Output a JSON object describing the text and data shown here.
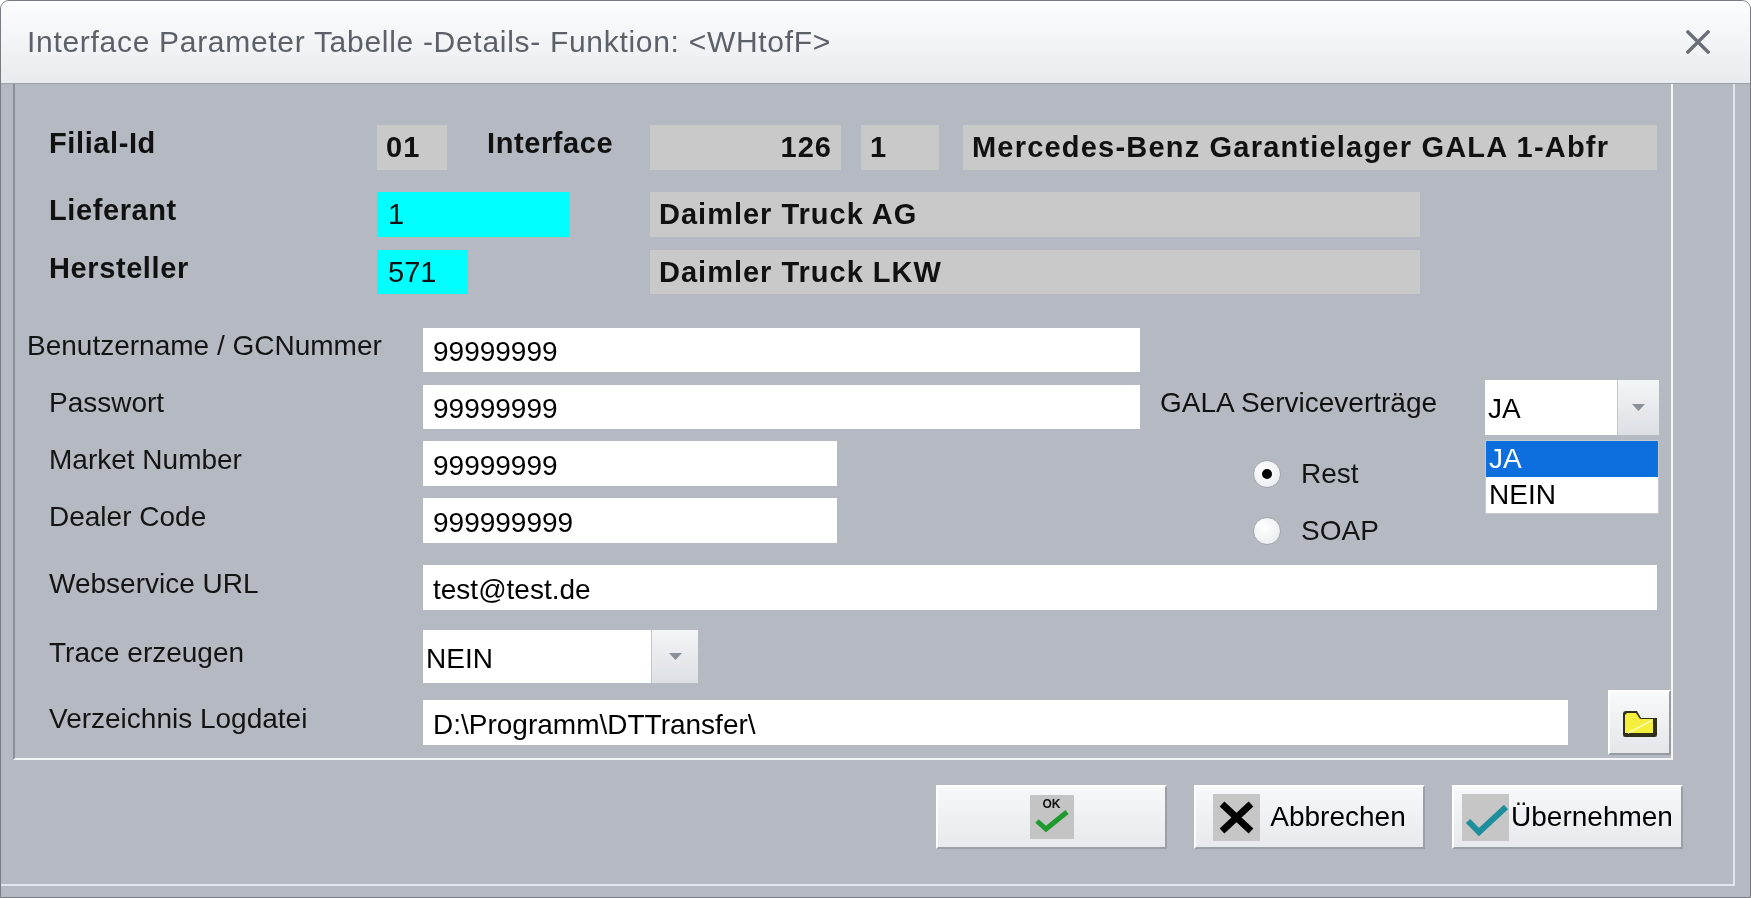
{
  "window": {
    "title": "Interface Parameter Tabelle -Details- Funktion: <WHtofF>"
  },
  "header": {
    "rows": [
      {
        "cells": [
          {
            "kind": "label",
            "text": "Filial-Id"
          },
          {
            "kind": "text",
            "text": "01"
          },
          {
            "kind": "label",
            "text": "Interface"
          },
          {
            "kind": "numeric",
            "text": "126"
          },
          {
            "kind": "text",
            "text": "1"
          },
          {
            "kind": "text",
            "text": "Mercedes-Benz Garantielager GALA 1-Abfr"
          }
        ]
      },
      {
        "cells": [
          {
            "kind": "label",
            "text": "Lieferant"
          },
          {
            "kind": "lookup",
            "text": "1"
          },
          {
            "kind": "text",
            "text": "Daimler Truck AG"
          }
        ]
      },
      {
        "cells": [
          {
            "kind": "label",
            "text": "Hersteller"
          },
          {
            "kind": "lookup",
            "text": "571"
          },
          {
            "kind": "text",
            "text": "Daimler Truck LKW"
          }
        ]
      }
    ]
  },
  "form": {
    "fields": [
      {
        "label": "Benutzername / GCNummer",
        "value": "99999999",
        "kind": "text"
      },
      {
        "label": "Passwort",
        "value": "99999999",
        "kind": "text"
      },
      {
        "label": "Market Number",
        "value": "99999999",
        "kind": "text"
      },
      {
        "label": "Dealer Code",
        "value": "999999999",
        "kind": "text"
      },
      {
        "label": "Webservice URL",
        "value": "test@test.de",
        "kind": "text"
      },
      {
        "label": "Trace erzeugen",
        "value": "NEIN",
        "kind": "combo"
      },
      {
        "label": "Verzeichnis Logdatei",
        "value": "D:\\Programm\\DTTransfer\\",
        "kind": "path"
      }
    ],
    "service_contracts": {
      "label": "GALA Serviceverträge",
      "value": "JA",
      "expanded": true,
      "options": [
        {
          "label": "JA",
          "selected": true
        },
        {
          "label": "NEIN",
          "selected": false
        }
      ]
    },
    "protocol": [
      {
        "label": "Rest",
        "selected": true
      },
      {
        "label": "SOAP",
        "selected": false
      }
    ]
  },
  "buttons": [
    {
      "label": "OK",
      "kind": "ok"
    },
    {
      "label": "Abbrechen",
      "kind": "cancel"
    },
    {
      "label": "Übernehmen",
      "kind": "apply"
    }
  ]
}
